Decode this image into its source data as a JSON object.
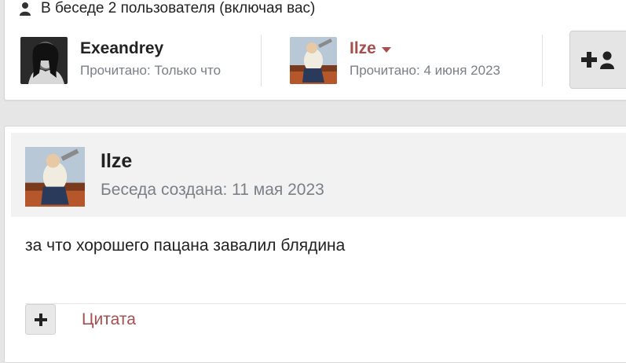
{
  "participants": {
    "header_text": "В беседе 2 пользователя (включая вас)",
    "icon": "user-icon",
    "list": [
      {
        "name": "Exeandrey",
        "read_status": "Прочитано: Только что",
        "avatar": "woman-portrait-avatar"
      },
      {
        "name": "Ilze",
        "read_status": "Прочитано: 4 июня 2023",
        "avatar": "painting-avatar",
        "has_dropdown": true
      }
    ],
    "invite_button": {
      "icon": "add-user-icon"
    }
  },
  "message": {
    "author": "Ilze",
    "created": "Беседа создана: 11 мая 2023",
    "body": "за что хорошего пацана завалил блядина",
    "quote_label": "Цитата",
    "plus_icon": "plus-icon"
  },
  "colors": {
    "accent": "#a74e4e",
    "muted": "#7a8086",
    "text": "#222222"
  }
}
